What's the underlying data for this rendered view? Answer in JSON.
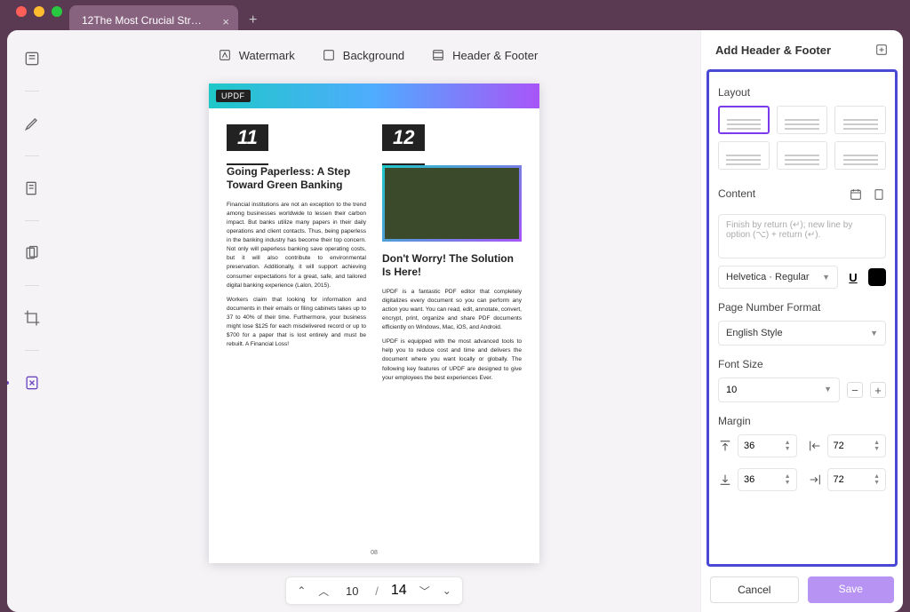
{
  "window": {
    "tab_title": "12The Most Crucial Strate..."
  },
  "topbar": {
    "watermark": "Watermark",
    "background": "Background",
    "header_footer": "Header & Footer"
  },
  "document": {
    "brand": "UPDF",
    "col1": {
      "badge": "11",
      "title": "Going Paperless: A Step Toward Green Banking",
      "p1": "Financial institutions are not an exception to the trend among businesses worldwide to lessen their carbon impact. But banks utilize many papers in their daily operations and client contacts. Thus, being paperless in the banking industry has become their top concern. Not only will paperless banking save operating costs, but it will also contribute to environmental preservation. Additionally, it will support achieving consumer expectations for a great, safe, and tailored digital banking experience (Lalon, 2015).",
      "p2": "Workers claim that looking for information and documents in their emails or filing cabinets takes up to 37 to 40% of their time. Furthermore, your business might lose $125 for each misdelivered record or up to $700 for a paper that is lost entirely and must be rebuilt. A Financial Loss!"
    },
    "col2": {
      "badge": "12",
      "title": "Don't Worry! The Solution Is Here!",
      "p1": "UPDF is a fantastic PDF editor that completely digitalizes every document so you can perform any action you want. You can read, edit, annotate, convert, encrypt, print, organize and share PDF documents efficiently on Windows, Mac, iOS, and Android.",
      "p2": "UPDF is equipped with the most advanced tools to help you to reduce cost and time and delivers the document where you want locally or globally. The following key features of UPDF are designed to give your employees the best experiences Ever."
    },
    "page_number": "08"
  },
  "pager": {
    "current": "10",
    "total": "14"
  },
  "panel": {
    "title": "Add Header & Footer",
    "layout_label": "Layout",
    "content_label": "Content",
    "content_placeholder": "Finish by return (↵); new line by option (⌥) + return (↵).",
    "font": "Helvetica · Regular",
    "page_number_format_label": "Page Number Format",
    "page_number_format_value": "English Style",
    "font_size_label": "Font Size",
    "font_size_value": "10",
    "margin_label": "Margin",
    "margin": {
      "top": "36",
      "left": "72",
      "bottom": "36",
      "right": "72"
    },
    "cancel": "Cancel",
    "save": "Save"
  }
}
